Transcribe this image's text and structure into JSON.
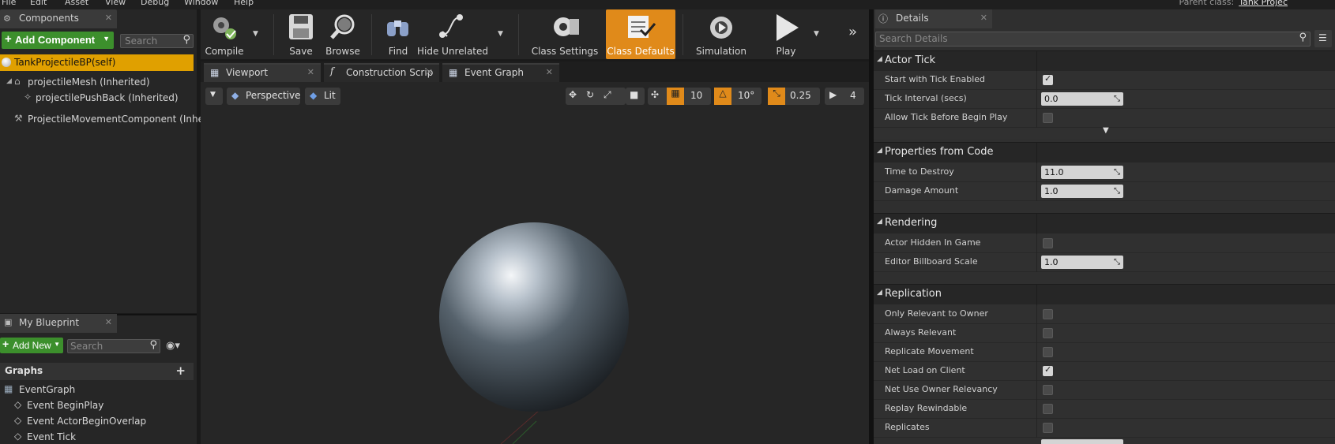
{
  "menu": [
    "File",
    "Edit",
    "Asset",
    "View",
    "Debug",
    "Window",
    "Help"
  ],
  "parent_class": {
    "label": "Parent class:",
    "value": "Tank Projec"
  },
  "components_panel": {
    "title": "Components",
    "add_button": "Add Component",
    "search_placeholder": "Search",
    "self_item": "TankProjectileBP(self)",
    "tree": [
      {
        "label": "projectileMesh (Inherited)"
      },
      {
        "label": "projectilePushBack (Inherited)"
      },
      {
        "label": "ProjectileMovementComponent (Inherit"
      }
    ]
  },
  "toolbar": {
    "compile": "Compile",
    "save": "Save",
    "browse": "Browse",
    "find": "Find",
    "hide_unrelated": "Hide Unrelated",
    "class_settings": "Class Settings",
    "class_defaults": "Class Defaults",
    "simulation": "Simulation",
    "play": "Play"
  },
  "editor_tabs": [
    "Viewport",
    "Construction Scrip",
    "Event Graph"
  ],
  "viewport": {
    "perspective": "Perspective",
    "lit": "Lit",
    "grid_snap": "10",
    "rot_snap": "10°",
    "scale_snap": "0.25",
    "camera_speed": "4"
  },
  "my_blueprint": {
    "title": "My Blueprint",
    "add_new": "Add New",
    "search_placeholder": "Search",
    "graphs_header": "Graphs",
    "items": [
      "EventGraph",
      "Event BeginPlay",
      "Event ActorBeginOverlap",
      "Event Tick"
    ]
  },
  "details": {
    "title": "Details",
    "search_placeholder": "Search Details",
    "sections": {
      "actor_tick": "Actor Tick",
      "properties_from_code": "Properties from Code",
      "rendering": "Rendering",
      "replication": "Replication"
    },
    "actor_tick": [
      {
        "name": "Start with Tick Enabled",
        "checked": true
      },
      {
        "name": "Tick Interval (secs)",
        "value": "0.0"
      },
      {
        "name": "Allow Tick Before Begin Play",
        "checked": false
      }
    ],
    "properties_from_code": [
      {
        "name": "Time to Destroy",
        "value": "11.0"
      },
      {
        "name": "Damage Amount",
        "value": "1.0"
      }
    ],
    "rendering": [
      {
        "name": "Actor Hidden In Game",
        "checked": false
      },
      {
        "name": "Editor Billboard Scale",
        "value": "1.0"
      }
    ],
    "replication": [
      {
        "name": "Only Relevant to Owner",
        "checked": false
      },
      {
        "name": "Always Relevant",
        "checked": false
      },
      {
        "name": "Replicate Movement",
        "checked": false
      },
      {
        "name": "Net Load on Client",
        "checked": true
      },
      {
        "name": "Net Use Owner Relevancy",
        "checked": false
      },
      {
        "name": "Replay Rewindable",
        "checked": false
      },
      {
        "name": "Replicates",
        "checked": false
      }
    ]
  },
  "colors": {
    "accent_orange": "#e08a1a",
    "add_green": "#3c8f2c",
    "selected_yellow": "#e0a000"
  }
}
